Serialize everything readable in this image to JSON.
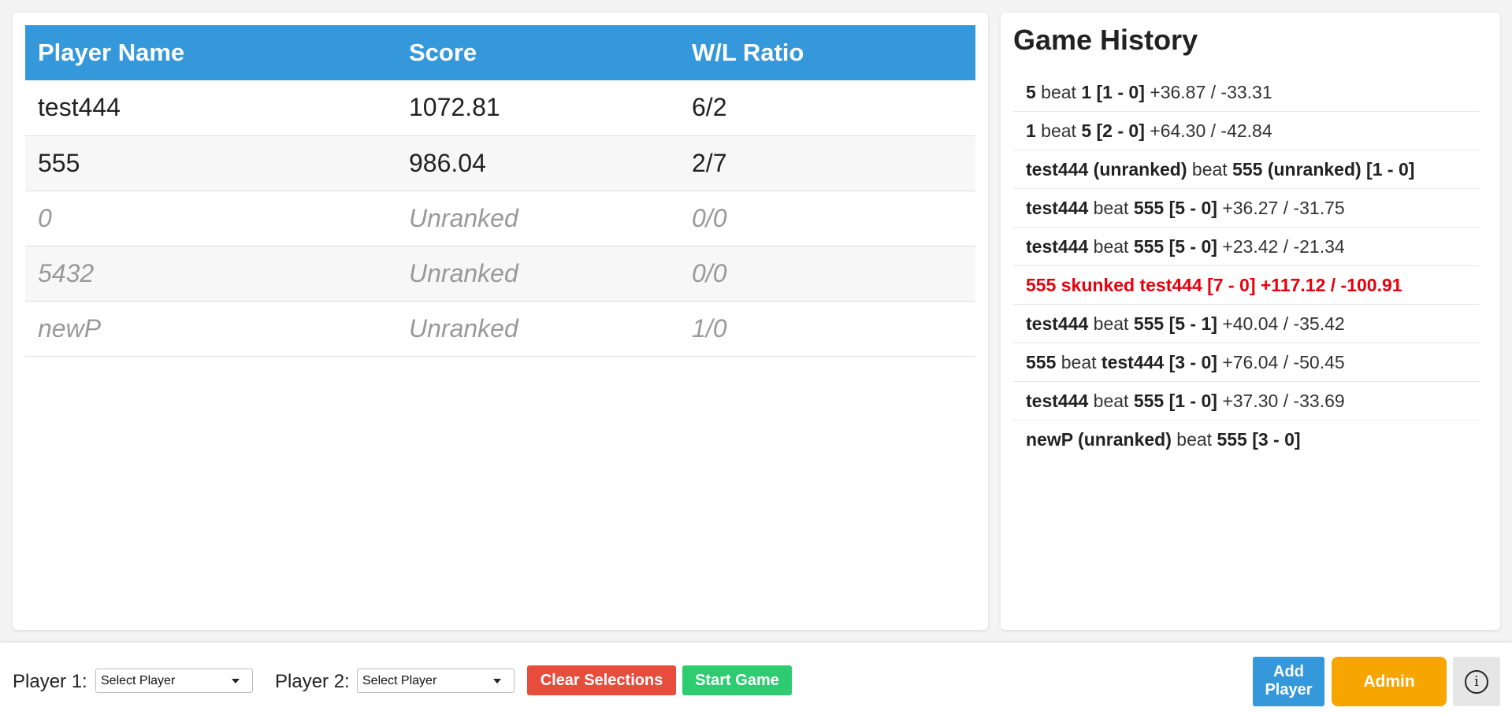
{
  "leaderboard": {
    "headers": [
      "Player Name",
      "Score",
      "W/L Ratio"
    ],
    "rows": [
      {
        "name": "test444",
        "score": "1072.81",
        "wl": "6/2",
        "ranked": true
      },
      {
        "name": "555",
        "score": "986.04",
        "wl": "2/7",
        "ranked": true
      },
      {
        "name": "0",
        "score": "Unranked",
        "wl": "0/0",
        "ranked": false
      },
      {
        "name": "5432",
        "score": "Unranked",
        "wl": "0/0",
        "ranked": false
      },
      {
        "name": "newP",
        "score": "Unranked",
        "wl": "1/0",
        "ranked": false
      }
    ]
  },
  "history": {
    "title": "Game History",
    "entries": [
      {
        "parts": [
          {
            "t": "5",
            "b": true
          },
          {
            "t": " beat ",
            "b": false
          },
          {
            "t": "1 [1 - 0]",
            "b": true
          },
          {
            "t": " +36.87 / -33.31",
            "b": false
          }
        ],
        "highlight": false
      },
      {
        "parts": [
          {
            "t": "1",
            "b": true
          },
          {
            "t": " beat ",
            "b": false
          },
          {
            "t": "5 [2 - 0]",
            "b": true
          },
          {
            "t": " +64.30 / -42.84",
            "b": false
          }
        ],
        "highlight": false
      },
      {
        "parts": [
          {
            "t": "test444 (unranked)",
            "b": true
          },
          {
            "t": " beat ",
            "b": false
          },
          {
            "t": "555 (unranked) [1 - 0]",
            "b": true
          }
        ],
        "highlight": false
      },
      {
        "parts": [
          {
            "t": "test444",
            "b": true
          },
          {
            "t": " beat ",
            "b": false
          },
          {
            "t": "555 [5 - 0]",
            "b": true
          },
          {
            "t": " +36.27 / -31.75",
            "b": false
          }
        ],
        "highlight": false
      },
      {
        "parts": [
          {
            "t": "test444",
            "b": true
          },
          {
            "t": " beat ",
            "b": false
          },
          {
            "t": "555 [5 - 0]",
            "b": true
          },
          {
            "t": " +23.42 / -21.34",
            "b": false
          }
        ],
        "highlight": false
      },
      {
        "parts": [
          {
            "t": "555 skunked test444 [7 - 0] +117.12 / -100.91",
            "b": true
          }
        ],
        "highlight": true
      },
      {
        "parts": [
          {
            "t": "test444",
            "b": true
          },
          {
            "t": " beat ",
            "b": false
          },
          {
            "t": "555 [5 - 1]",
            "b": true
          },
          {
            "t": " +40.04 / -35.42",
            "b": false
          }
        ],
        "highlight": false
      },
      {
        "parts": [
          {
            "t": "555",
            "b": true
          },
          {
            "t": " beat ",
            "b": false
          },
          {
            "t": "test444 [3 - 0]",
            "b": true
          },
          {
            "t": " +76.04 / -50.45",
            "b": false
          }
        ],
        "highlight": false
      },
      {
        "parts": [
          {
            "t": "test444",
            "b": true
          },
          {
            "t": " beat ",
            "b": false
          },
          {
            "t": "555 [1 - 0]",
            "b": true
          },
          {
            "t": " +37.30 / -33.69",
            "b": false
          }
        ],
        "highlight": false
      },
      {
        "parts": [
          {
            "t": "newP (unranked)",
            "b": true
          },
          {
            "t": " beat ",
            "b": false
          },
          {
            "t": "555 [3 - 0]",
            "b": true
          }
        ],
        "highlight": false
      }
    ]
  },
  "footer": {
    "player1_label": "Player 1:",
    "player1_value": "Select Player",
    "player2_label": "Player 2:",
    "player2_value": "Select Player",
    "clear_label": "Clear Selections",
    "start_label": "Start Game",
    "add_player_line1": "Add",
    "add_player_line2": "Player",
    "admin_label": "Admin",
    "info_glyph": "i",
    "info_icon": "info-circle-icon"
  },
  "colors": {
    "header_blue": "#3498db",
    "clear_red": "#e74c3c",
    "start_green": "#2ecc71",
    "admin_orange": "#f7a500",
    "skunk_red": "#e8000d"
  }
}
